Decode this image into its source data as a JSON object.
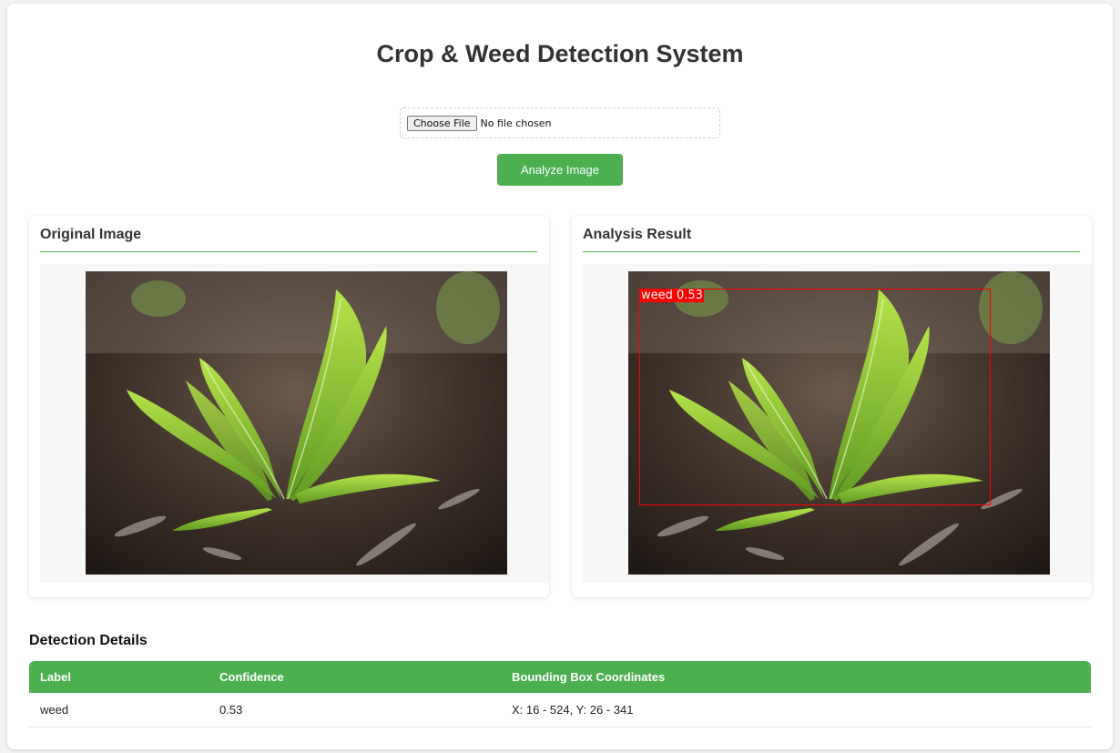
{
  "header": {
    "title": "Crop & Weed Detection System"
  },
  "upload": {
    "button_label": "Choose File",
    "status": "No file chosen"
  },
  "actions": {
    "analyze_label": "Analyze Image"
  },
  "panels": {
    "original": {
      "title": "Original Image"
    },
    "result": {
      "title": "Analysis Result"
    }
  },
  "detection_overlay": {
    "label": "weed 0.53",
    "color": "#ff0000"
  },
  "details": {
    "title": "Detection Details",
    "columns": [
      "Label",
      "Confidence",
      "Bounding Box Coordinates"
    ],
    "rows": [
      {
        "label": "weed",
        "confidence": "0.53",
        "bbox": "X: 16 - 524, Y: 26 - 341"
      }
    ]
  },
  "colors": {
    "accent": "#4caf50",
    "box": "#ff0000"
  }
}
